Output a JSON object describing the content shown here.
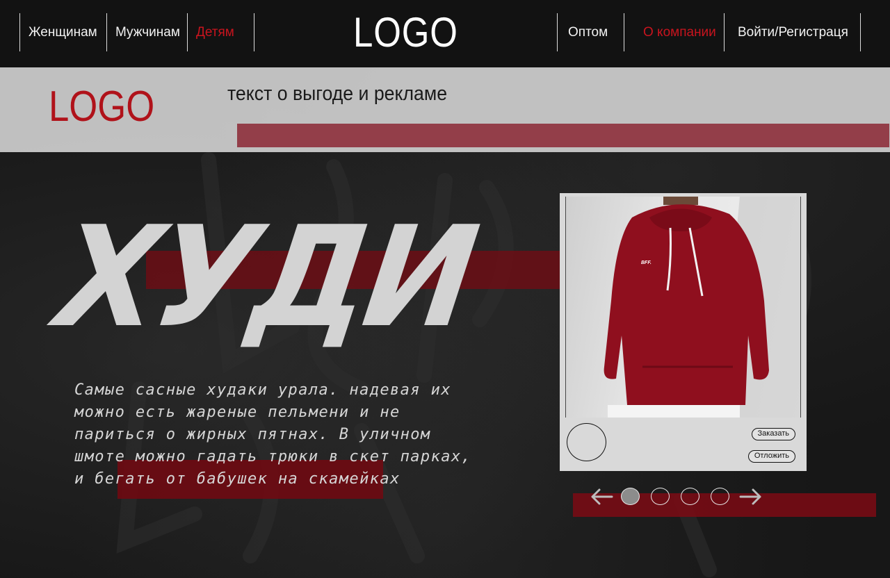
{
  "nav": {
    "left": [
      {
        "label": "Женщинам"
      },
      {
        "label": "Мужчинам"
      },
      {
        "label": "Детям"
      }
    ],
    "logo": "LOGO",
    "right": [
      {
        "label": "Оптом"
      },
      {
        "label": "О компании"
      },
      {
        "label": "Войти/Регистраця"
      }
    ]
  },
  "promo": {
    "logo": "LOGO",
    "text": "текст о выгоде и рекламе"
  },
  "hero": {
    "title": "ХУДИ",
    "description": "Самые сасные худаки урала. надевая их можно есть жареные пельмени и не париться о жирных пятнах. В уличном шмоте можно гадать трюки в скет парках, и бегать от бабушек на скамейках"
  },
  "card": {
    "print_label": "BFF.",
    "order_button": "Заказать",
    "later_button": "Отложить"
  },
  "slider": {
    "dots": 4,
    "active_index": 0
  },
  "colors": {
    "accent": "#c8141e",
    "bar": "#7a0a12",
    "background": "#171717"
  }
}
